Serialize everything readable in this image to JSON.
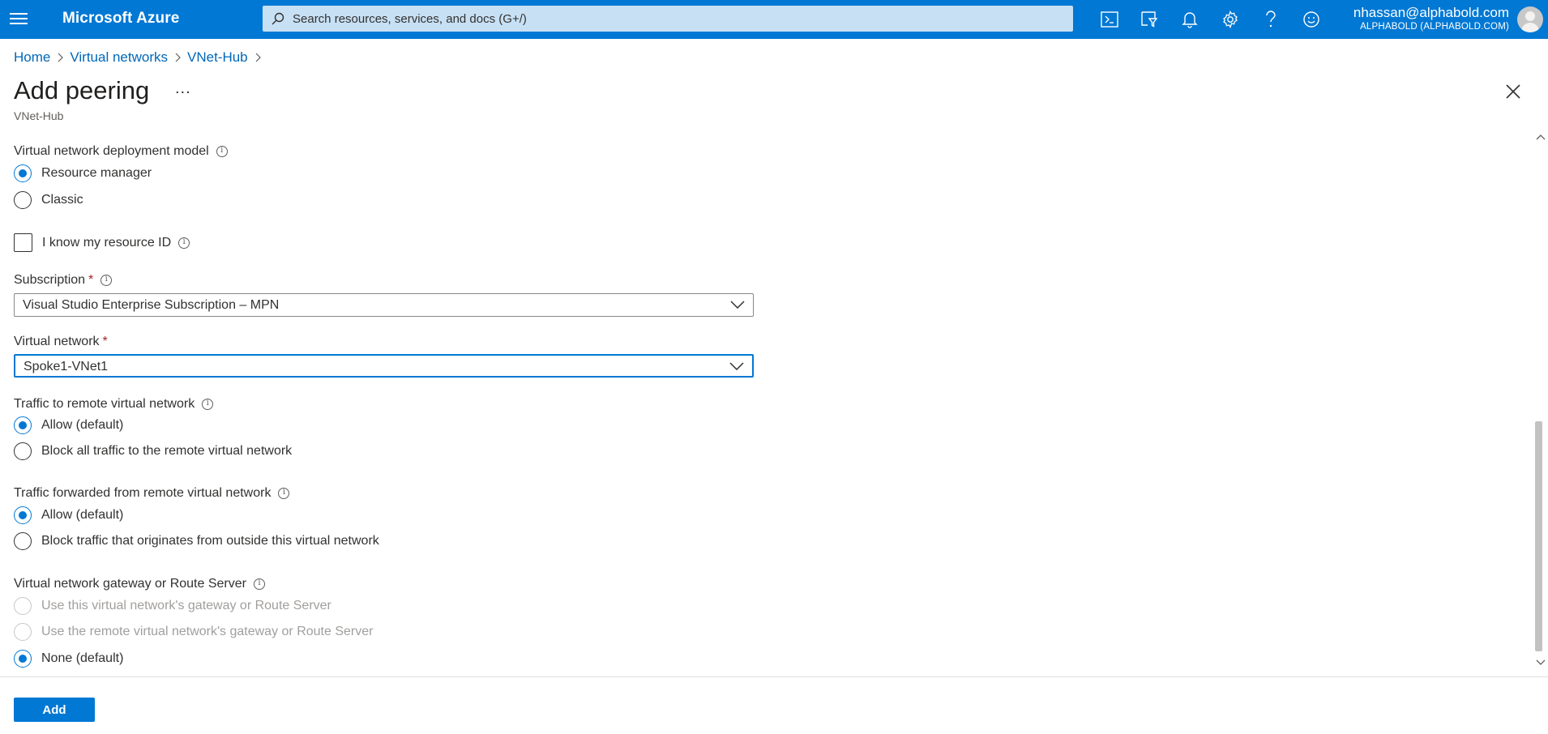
{
  "topbar": {
    "brand": "Microsoft Azure",
    "search_placeholder": "Search resources, services, and docs (G+/)",
    "user_email": "nhassan@alphabold.com",
    "user_tenant": "ALPHABOLD (ALPHABOLD.COM)",
    "icons": [
      "cloud-shell-icon",
      "directory-filter-icon",
      "notifications-icon",
      "settings-icon",
      "help-icon",
      "feedback-icon"
    ]
  },
  "breadcrumb": [
    "Home",
    "Virtual networks",
    "VNet-Hub"
  ],
  "header": {
    "title": "Add peering",
    "more": "...",
    "subtitle": "VNet-Hub"
  },
  "form": {
    "deployment_model": {
      "label": "Virtual network deployment model",
      "options": [
        "Resource manager",
        "Classic"
      ],
      "selected": 0
    },
    "resource_id": {
      "label": "I know my resource ID",
      "checked": false
    },
    "subscription": {
      "label": "Subscription",
      "required": "*",
      "value": "Visual Studio Enterprise Subscription – MPN"
    },
    "virtual_network": {
      "label": "Virtual network",
      "required": "*",
      "value": "Spoke1-VNet1"
    },
    "traffic_remote": {
      "label": "Traffic to remote virtual network",
      "options": [
        "Allow (default)",
        "Block all traffic to the remote virtual network"
      ],
      "selected": 0
    },
    "traffic_forwarded": {
      "label": "Traffic forwarded from remote virtual network",
      "options": [
        "Allow (default)",
        "Block traffic that originates from outside this virtual network"
      ],
      "selected": 0
    },
    "gateway": {
      "label": "Virtual network gateway or Route Server",
      "options": [
        "Use this virtual network's gateway or Route Server",
        "Use the remote virtual network's gateway or Route Server",
        "None (default)"
      ],
      "selected": 2,
      "disabled": [
        0,
        1
      ]
    }
  },
  "footer": {
    "add_label": "Add"
  }
}
